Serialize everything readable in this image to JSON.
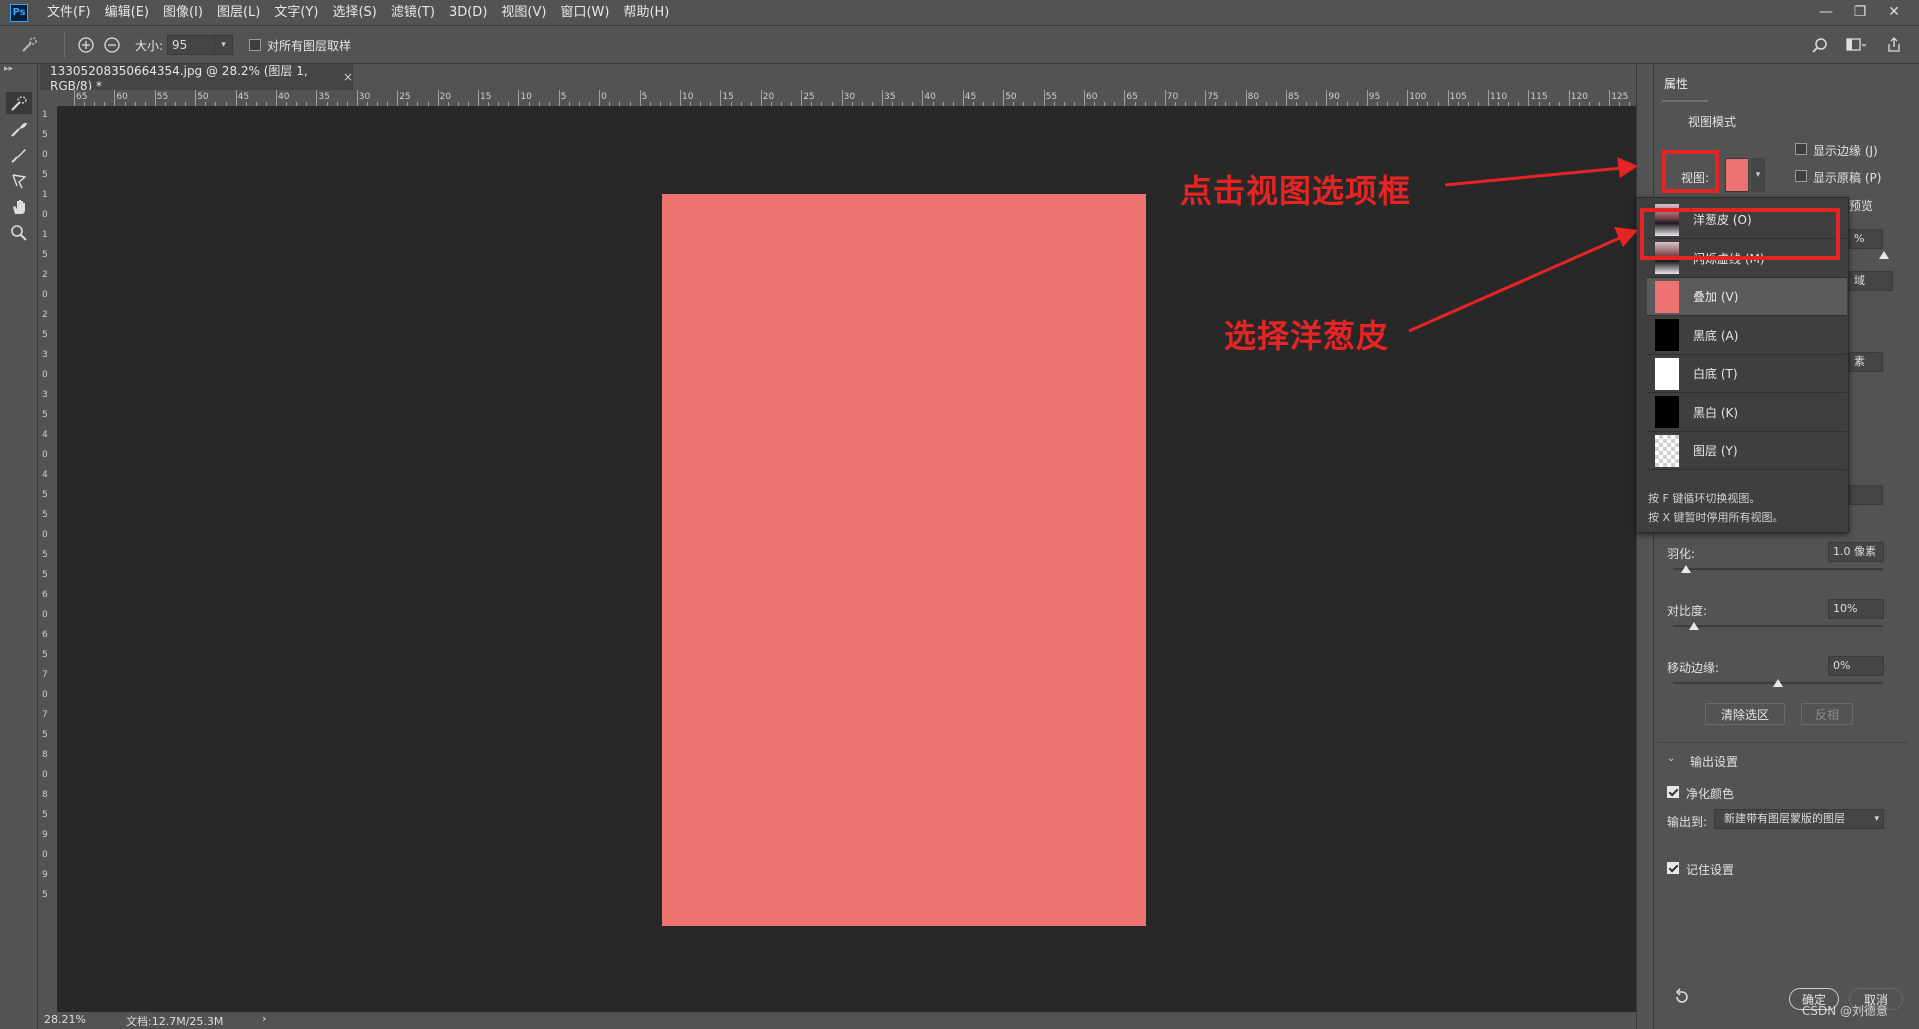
{
  "menubar": {
    "logo": "Ps",
    "items": [
      "文件(F)",
      "编辑(E)",
      "图像(I)",
      "图层(L)",
      "文字(Y)",
      "选择(S)",
      "滤镜(T)",
      "3D(D)",
      "视图(V)",
      "窗口(W)",
      "帮助(H)"
    ],
    "window_buttons": [
      "—",
      "❐",
      "✕"
    ]
  },
  "options": {
    "size_label": "大小:",
    "size_value": "95",
    "sample_all_layers": "对所有图层取样"
  },
  "document": {
    "tab_title": "13305208350664354.jpg @ 28.2% (图层 1, RGB/8) *",
    "tab_close": "×",
    "image_color": "#ec7372",
    "zoom": "28.21%",
    "doc_size": "文档:12.7M/25.3M",
    "status_arrow": "›"
  },
  "ruler": {
    "top_labels": [
      "65",
      "60",
      "55",
      "50",
      "45",
      "40",
      "35",
      "30",
      "25",
      "20",
      "15",
      "10",
      "5",
      "0",
      "5",
      "10",
      "15",
      "20",
      "25",
      "30",
      "35",
      "40",
      "45",
      "50",
      "55",
      "60",
      "65",
      "70",
      "75",
      "80",
      "85",
      "90",
      "95",
      "100",
      "105",
      "110",
      "115",
      "120",
      "125"
    ],
    "left_labels": [
      "1",
      "5",
      "0",
      "5",
      "1",
      "0",
      "1",
      "5",
      "2",
      "0",
      "2",
      "5",
      "3",
      "0",
      "3",
      "5",
      "4",
      "0",
      "4",
      "5",
      "5",
      "0",
      "5",
      "5",
      "6",
      "0",
      "6",
      "5",
      "7",
      "0",
      "7",
      "5",
      "8",
      "0",
      "8",
      "5",
      "9",
      "0",
      "9",
      "5"
    ]
  },
  "panel": {
    "tab": "属性",
    "view_mode_title": "视图模式",
    "view_label": "视图:",
    "show_edge": "显示边缘 (J)",
    "show_original": "显示原稿 (P)",
    "partial_preview_tail": "预览",
    "radius_pct_tail": "%",
    "region_tail": "域",
    "pixel_tail": "素",
    "feather_label": "羽化:",
    "feather_value": "1.0 像素",
    "contrast_label": "对比度:",
    "contrast_value": "10%",
    "shift_edge_label": "移动边缘:",
    "shift_edge_value": "0%",
    "clear_selection": "清除选区",
    "invert": "反相",
    "output_settings": "输出设置",
    "decontaminate": "净化颜色",
    "output_to_label": "输出到:",
    "output_to_value": "新建带有图层蒙版的图层",
    "remember": "记住设置",
    "ok": "确定",
    "cancel": "取消",
    "watermark": "CSDN @刘德意",
    "sliders": {
      "feather": 0.06,
      "contrast": 0.1,
      "shift_edge": 0.5
    }
  },
  "view_dropdown": {
    "items": [
      {
        "label": "洋葱皮 (O)",
        "thumb": "photo",
        "selected": false
      },
      {
        "label": "闪烁虚线 (M)",
        "thumb": "photo",
        "selected": false
      },
      {
        "label": "叠加 (V)",
        "thumb": "#ec7372",
        "selected": true
      },
      {
        "label": "黑底 (A)",
        "thumb": "#000000",
        "selected": false
      },
      {
        "label": "白底 (T)",
        "thumb": "#ffffff",
        "selected": false
      },
      {
        "label": "黑白 (K)",
        "thumb": "#000000",
        "selected": false
      },
      {
        "label": "图层 (Y)",
        "thumb": "checker",
        "selected": false
      }
    ],
    "hint1": "按 F 键循环切换视图。",
    "hint2": "按 X 键暂时停用所有视图。"
  },
  "annotations": {
    "click_view": "点击视图选项框",
    "choose_onion": "选择洋葱皮",
    "color": "#e52424"
  }
}
